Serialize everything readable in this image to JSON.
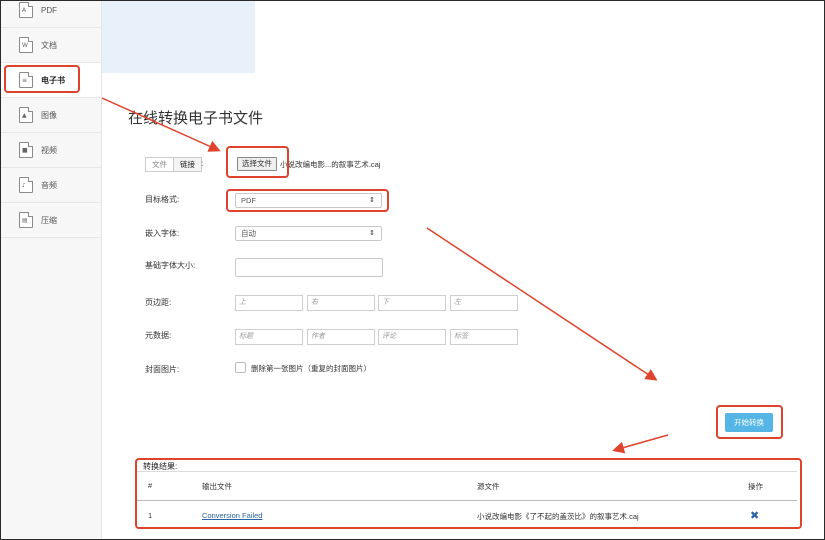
{
  "sidebar": {
    "items": [
      {
        "label": "PDF",
        "icon": "pdf-file-icon"
      },
      {
        "label": "文档",
        "icon": "word-file-icon"
      },
      {
        "label": "电子书",
        "icon": "ebook-file-icon",
        "active": true
      },
      {
        "label": "图像",
        "icon": "image-file-icon"
      },
      {
        "label": "视频",
        "icon": "video-file-icon"
      },
      {
        "label": "音频",
        "icon": "audio-file-icon"
      },
      {
        "label": "压缩",
        "icon": "archive-file-icon"
      }
    ]
  },
  "main": {
    "title": "在线转换电子书文件",
    "source": {
      "tab_file": "文件",
      "tab_link": "链接",
      "colon": ":",
      "choose_button": "选择文件",
      "file_name": "小说改编电影...的叙事艺术.caj"
    },
    "target_format": {
      "label": "目标格式:",
      "value": "PDF"
    },
    "embed_font": {
      "label": "嵌入字体:",
      "value": "自动"
    },
    "base_font_size": {
      "label": "基础字体大小:",
      "value": ""
    },
    "margins": {
      "label": "页边距:",
      "placeholders": [
        "上",
        "右",
        "下",
        "左"
      ]
    },
    "metadata": {
      "label": "元数据:",
      "placeholders": [
        "标题",
        "作者",
        "评论",
        "标签"
      ]
    },
    "cover": {
      "label": "封面图片:",
      "checkbox_label": "删除第一张图片（重复的封面图片）",
      "checked": false
    },
    "start_button": "开始转换"
  },
  "results": {
    "title": "转换结果:",
    "columns": [
      "#",
      "输出文件",
      "源文件",
      "操作"
    ],
    "rows": [
      {
        "index": "1",
        "output": "Conversion Failed",
        "source": "小说改编电影《了不起的盖茨比》的叙事艺术.caj",
        "action_icon": "delete-x-icon"
      }
    ]
  },
  "colors": {
    "accent": "#55b6e6",
    "annotation": "#e0432c",
    "link": "#2a63a8"
  }
}
